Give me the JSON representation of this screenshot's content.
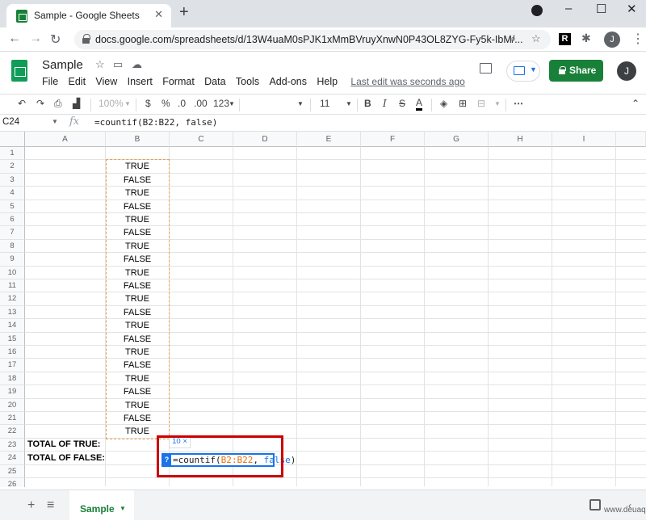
{
  "browser": {
    "tab_title": "Sample - Google Sheets",
    "url": "docs.google.com/spreadsheets/d/13W4uaM0sPJK1xMmBVruyXnwN0P43OL8ZYG-Fy5k-IbM/...",
    "profile_initial": "J",
    "ext_letter": "R"
  },
  "app": {
    "title": "Sample",
    "menu": [
      "File",
      "Edit",
      "View",
      "Insert",
      "Format",
      "Data",
      "Tools",
      "Add-ons",
      "Help"
    ],
    "last_edit": "Last edit was seconds ago",
    "share_label": "Share",
    "profile_initial": "J"
  },
  "toolbar": {
    "zoom": "100%",
    "currency": "$",
    "percent": "%",
    "dec_dec": ".0",
    "dec_inc": ".00",
    "format_more": "123",
    "font_size": "11",
    "bold": "B",
    "italic": "I",
    "strike": "S",
    "text_color": "A"
  },
  "formula_bar": {
    "cell_ref": "C24",
    "fx": "fx",
    "formula": "=countif(B2:B22, false)"
  },
  "grid": {
    "columns": [
      "A",
      "B",
      "C",
      "D",
      "E",
      "F",
      "G",
      "H",
      "I"
    ],
    "rows": [
      "1",
      "2",
      "3",
      "4",
      "5",
      "6",
      "7",
      "8",
      "9",
      "10",
      "11",
      "12",
      "13",
      "14",
      "15",
      "16",
      "17",
      "18",
      "19",
      "20",
      "21",
      "22",
      "23",
      "24",
      "25",
      "26"
    ],
    "col_b_values": [
      "TRUE",
      "FALSE",
      "TRUE",
      "FALSE",
      "TRUE",
      "FALSE",
      "TRUE",
      "FALSE",
      "TRUE",
      "FALSE",
      "TRUE",
      "FALSE",
      "TRUE",
      "FALSE",
      "TRUE",
      "FALSE",
      "TRUE",
      "FALSE",
      "TRUE",
      "FALSE",
      "TRUE"
    ],
    "a23": "TOTAL OF TRUE:",
    "a24": "TOTAL OF FALSE:",
    "suggestion": "10 ×",
    "editor": {
      "help": "?",
      "prefix": "=countif(",
      "range": "B2:B22",
      "sep": ", ",
      "kw": "false",
      "suffix": ")"
    }
  },
  "sheets": {
    "active_tab": "Sample"
  },
  "watermark": "www.deuaq.com",
  "colors": {
    "accent": "#1a73e8",
    "share_green": "#188038",
    "highlight_red": "#cc0000",
    "range_orange": "#e8a053"
  }
}
